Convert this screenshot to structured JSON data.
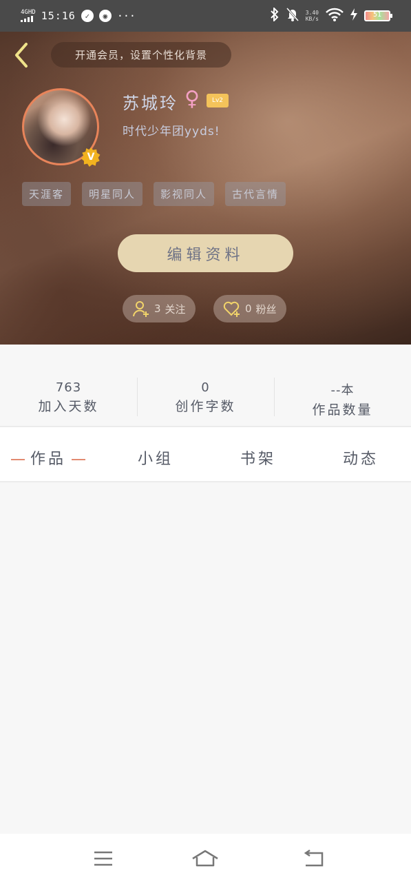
{
  "statusbar": {
    "network": "4GHD",
    "time": "15:16",
    "speed_value": "3.40",
    "speed_unit": "KB/s",
    "battery": "51",
    "more": "···"
  },
  "header": {
    "vip_prompt": "开通会员，设置个性化背景",
    "name": "苏城玲",
    "gender_symbol": "♀",
    "level": "Lv2",
    "signature": "时代少年团yyds!",
    "tags": [
      "天涯客",
      "明星同人",
      "影视同人",
      "古代言情"
    ],
    "edit_button": "编辑资料",
    "following_count": "3",
    "following_label": "关注",
    "fans_count": "0",
    "fans_label": "粉丝"
  },
  "stats": [
    {
      "value": "763",
      "label": "加入天数"
    },
    {
      "value": "0",
      "label": "创作字数"
    },
    {
      "value": "--本",
      "label": "作品数量"
    }
  ],
  "tabs": [
    "作品",
    "小组",
    "书架",
    "动态"
  ],
  "active_tab": "作品",
  "colors": {
    "accent": "#e28a70",
    "edit_button_bg": "#e6d6b1",
    "level_badge": "#f4c35a",
    "avatar_border": "#e8845a"
  },
  "icons": {
    "back": "chevron-left-icon",
    "vip_badge": "v-badge-icon",
    "gender": "female-icon",
    "following": "user-plus-icon",
    "fans": "heart-plus-icon",
    "nav_menu": "menu-icon",
    "nav_home": "home-icon",
    "nav_back": "return-icon"
  }
}
